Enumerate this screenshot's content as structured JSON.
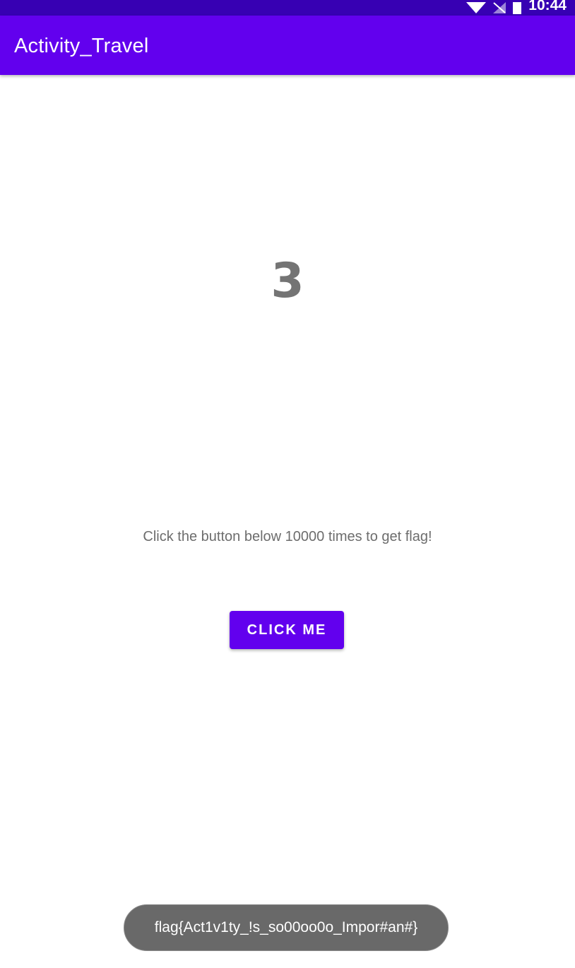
{
  "status_bar": {
    "time": "10:44",
    "icons": [
      "wifi-icon",
      "no-signal-icon",
      "battery-icon"
    ],
    "background": "#3700b3"
  },
  "app_bar": {
    "title": "Activity_Travel",
    "background": "#6200ee"
  },
  "main": {
    "counter": "3",
    "instruction": "Click the button below 10000 times to get flag!",
    "button_label": "CLICK ME",
    "button_color": "#6200ee"
  },
  "toast": {
    "message": "flag{Act1v1ty_!s_so00oo0o_Impor#an#}"
  }
}
